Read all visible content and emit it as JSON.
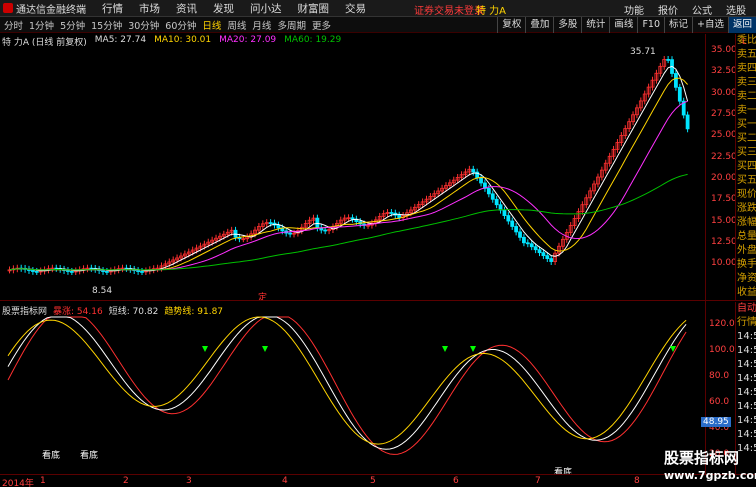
{
  "menubar": {
    "app_title": "通达信金融终端",
    "items": [
      "行情",
      "市场",
      "资讯",
      "发现",
      "问小达",
      "财富圈",
      "交易"
    ],
    "warning": "证券交易未登录",
    "stock_name": "特 力A",
    "right_items": [
      "功能",
      "报价",
      "公式",
      "选股"
    ]
  },
  "toolbar": {
    "period_tabs": [
      "分时",
      "1分钟",
      "5分钟",
      "15分钟",
      "30分钟",
      "60分钟",
      "日线",
      "周线",
      "月线",
      "多周期",
      "更多"
    ],
    "active_period": "日线",
    "right_buttons": [
      "复权",
      "叠加",
      "多股",
      "统计",
      "画线",
      "F10",
      "标记",
      "+自选",
      "返回"
    ]
  },
  "kline_header": {
    "stock": "特 力A (日线 前复权)",
    "ma5": "MA5: 27.74",
    "ma10": "MA10: 30.01",
    "ma20": "MA20: 27.09",
    "ma60": "MA60: 19.29"
  },
  "price_axis": [
    "35.00",
    "32.50",
    "30.00",
    "27.50",
    "25.00",
    "22.50",
    "20.00",
    "17.50",
    "15.00",
    "12.50",
    "10.00"
  ],
  "high_label": "35.71",
  "low_label": "8.54",
  "right_panel_labels": [
    "委比",
    "卖五",
    "卖四",
    "卖三",
    "卖二",
    "卖一",
    "买一",
    "买二",
    "买三",
    "买四",
    "买五",
    "现价",
    "涨跌",
    "涨幅",
    "总量",
    "外盘",
    "换手",
    "净资",
    "收益"
  ],
  "l_badge": "L",
  "indicator": {
    "name": "股票指标网",
    "line1": "暴涨: 54.16",
    "line2": "短线: 70.82",
    "line3": "趋势线: 91.87",
    "axis": [
      "120.0",
      "100.0",
      "80.0",
      "60.0",
      "40.0",
      "20.0"
    ],
    "current": "48.95",
    "annotations": [
      "看底",
      "看底",
      "看底"
    ],
    "right_labels": [
      "自动",
      "行情",
      "14:56",
      "14:56",
      "14:56",
      "14:56",
      "14:56",
      "14:56",
      "14:56",
      "14:56",
      "14:56"
    ]
  },
  "date_labels": [
    "2014年",
    "1",
    "2",
    "3",
    "4",
    "5",
    "6",
    "7",
    "8"
  ],
  "ding_label": "定",
  "watermark": {
    "title": "股票指标网",
    "url": "www.7gpzb.com"
  },
  "colors": {
    "up": "#ff3030",
    "down": "#00e5ff",
    "ma5": "#ffffff",
    "ma10": "#ffd400",
    "ma20": "#ff30ff",
    "ma60": "#00c000"
  }
}
